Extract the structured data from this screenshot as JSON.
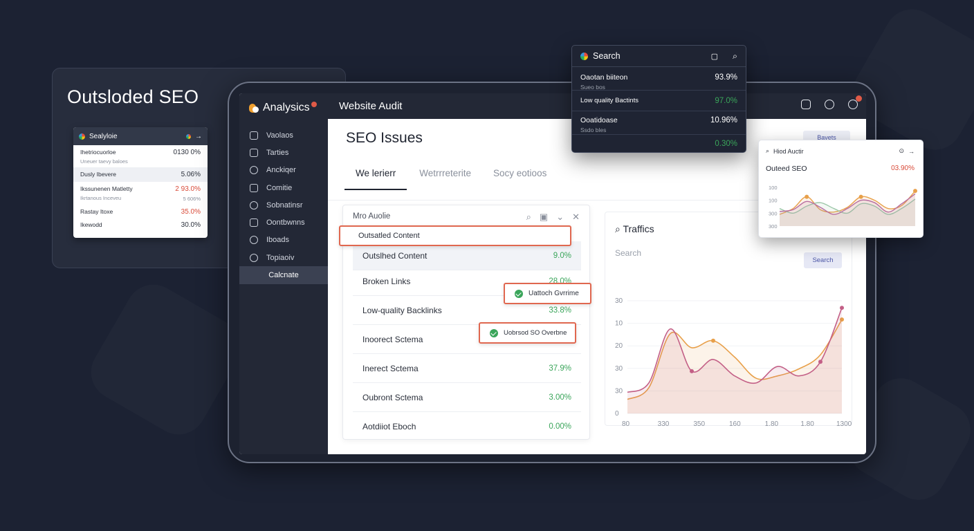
{
  "background_card": {
    "title": "Outsloded SEO",
    "mini": {
      "title": "Sealyloie",
      "rows": [
        {
          "label": "Ihetriocuorloe",
          "sub": "Uneuer taevy baloes",
          "value": "0130 0%",
          "color": "dark"
        },
        {
          "label": "Dusly Ibevere",
          "sub": "",
          "value": "5.06%",
          "color": "dark"
        },
        {
          "label": "Ikssunenen Matletty",
          "sub": "Ikrtanous Inceveu",
          "value": "2 93.0%",
          "value2": "5 606%",
          "color": "red"
        },
        {
          "label": "Rastay Itoxe",
          "sub": "",
          "value": "35.0%",
          "color": "red"
        },
        {
          "label": "Ikewodd",
          "sub": "",
          "value": "30.0%",
          "color": "dark"
        }
      ]
    }
  },
  "app": {
    "logo": "Analysics",
    "header_title": "Website Audit",
    "sidebar": [
      {
        "label": "Vaolaos",
        "icon": "list-icon"
      },
      {
        "label": "Tarties",
        "icon": "monitor-icon"
      },
      {
        "label": "Anckiqer",
        "icon": "gear-icon"
      },
      {
        "label": "Comitie",
        "icon": "box-icon"
      },
      {
        "label": "Sobnatinsr",
        "icon": "search-icon"
      },
      {
        "label": "Oontbwnns",
        "icon": "home-icon"
      },
      {
        "label": "Iboads",
        "icon": "doc-icon"
      },
      {
        "label": "Topiaoiv",
        "icon": "settings-icon"
      },
      {
        "label": "Calcnate",
        "icon": ""
      }
    ],
    "page_title": "SEO Issues",
    "tabs": [
      "We lerierr",
      "Wetrrreterite",
      "Socy eotioos"
    ],
    "hidden_button": "Bavets",
    "issues": {
      "header": "Mro Auolie",
      "highlight": "Outsatled Content",
      "rows": [
        {
          "label": "Outslhed Content",
          "pct": "9.0%"
        },
        {
          "label": "Broken Links",
          "pct": "28.0%"
        },
        {
          "label": "Low-quality Backlinks",
          "pct": "33.8%"
        },
        {
          "label": "Inoorect Sctema",
          "pct": ""
        },
        {
          "label": "Inerect Sctema",
          "pct": "37.9%"
        },
        {
          "label": "Oubront Sctema",
          "pct": "3.00%"
        },
        {
          "label": "Aotdiiot Eboch",
          "pct": "0.00%"
        }
      ],
      "badge1": "Uattoch Gvrrime",
      "badge2": "Uobrsod SO Overbne"
    },
    "traffic": {
      "title": "Traffics",
      "subtitle": "Search",
      "search_button": "Search"
    }
  },
  "float_search": {
    "title": "Search",
    "rows": [
      {
        "label": "Oaotan biiteon",
        "sub": "Sueo bos",
        "value": "93.9%",
        "color": "dark"
      },
      {
        "label": "Low quality Bactints",
        "sub": "",
        "value": "97.0%",
        "color": "green"
      },
      {
        "label": "Ooatidoase",
        "sub": "Ssdo bles",
        "value": "10.96%",
        "color": "dark"
      },
      {
        "label": "",
        "sub": "",
        "value": "0.30%",
        "color": "green"
      }
    ]
  },
  "float_audit": {
    "header": "Hiod Auctir",
    "title": "Outeed SEO",
    "value": "03.90%"
  },
  "chart_data": [
    {
      "type": "area",
      "title": "Traffics",
      "ylabel_ticks": [
        "30",
        "10",
        "20",
        "30",
        "30",
        "0"
      ],
      "xlabel_ticks": [
        "80",
        "330",
        "350",
        "160",
        "1.80",
        "1.80",
        "1300"
      ],
      "series": [
        {
          "color": "#e8a04a",
          "values": [
            6,
            11,
            34,
            28,
            31,
            24,
            15,
            16,
            19,
            25,
            40
          ]
        },
        {
          "color": "#c35f86",
          "values": [
            9,
            13,
            36,
            18,
            23,
            16,
            13,
            20,
            16,
            22,
            45
          ]
        }
      ]
    },
    {
      "type": "line",
      "title": "Outeed SEO",
      "ylabel_ticks": [
        "100",
        "100",
        "300",
        "300"
      ],
      "series": [
        {
          "color": "#e8a04a",
          "values": [
            20,
            30,
            50,
            28,
            24,
            32,
            50,
            44,
            30,
            35,
            60
          ]
        },
        {
          "color": "#9cc7a8",
          "values": [
            30,
            22,
            34,
            40,
            30,
            22,
            38,
            34,
            20,
            30,
            46
          ]
        },
        {
          "color": "#b86ea0",
          "values": [
            25,
            28,
            42,
            32,
            20,
            30,
            44,
            40,
            24,
            38,
            55
          ]
        }
      ]
    }
  ]
}
